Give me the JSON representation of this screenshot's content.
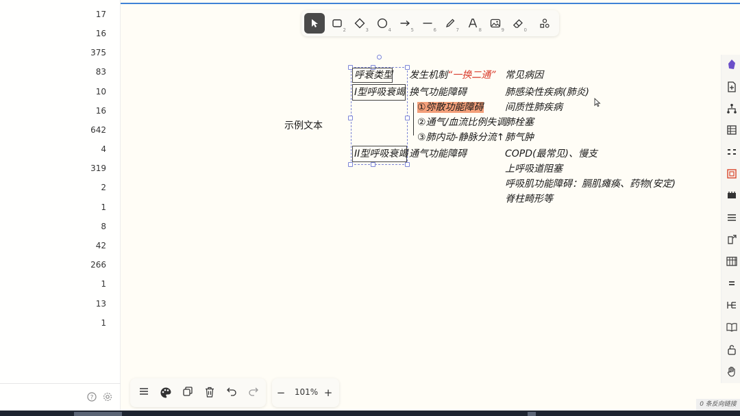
{
  "left_panel": {
    "counts": [
      "17",
      "16",
      "375",
      "83",
      "10",
      "16",
      "642",
      "4",
      "319",
      "2",
      "1",
      "8",
      "42",
      "266",
      "1",
      "13",
      "1"
    ],
    "footer_icons": [
      "help-icon",
      "settings-icon"
    ]
  },
  "toolbar": {
    "tools": [
      {
        "name": "select",
        "icon": "cursor-icon",
        "key": ""
      },
      {
        "name": "rectangle",
        "icon": "rectangle-icon",
        "key": "2"
      },
      {
        "name": "diamond",
        "icon": "diamond-icon",
        "key": "3"
      },
      {
        "name": "ellipse",
        "icon": "ellipse-icon",
        "key": "4"
      },
      {
        "name": "arrow",
        "icon": "arrow-icon",
        "key": "5"
      },
      {
        "name": "line",
        "icon": "line-icon",
        "key": "6"
      },
      {
        "name": "draw",
        "icon": "pencil-icon",
        "key": "7"
      },
      {
        "name": "text",
        "icon": "text-icon",
        "key": "8"
      },
      {
        "name": "image",
        "icon": "image-icon",
        "key": "9"
      },
      {
        "name": "eraser",
        "icon": "eraser-icon",
        "key": "0"
      },
      {
        "name": "library",
        "icon": "shapes-icon",
        "key": ""
      }
    ],
    "active_tool": "select"
  },
  "canvas": {
    "sample_text": "示例文本",
    "header": {
      "type": "呼衰类型",
      "mechanism_prefix": "发生机制",
      "mechanism_quote": "“一换二通”",
      "causes": "常见病因"
    },
    "type1": {
      "label": "I型呼吸衰竭",
      "mechanism": "换气功能障碍",
      "sub_items": [
        {
          "text": "①弥散功能障碍",
          "highlight": true
        },
        {
          "text": "②通气/血流比例失调",
          "highlight": false
        },
        {
          "text": "③肺内动-静脉分流↑",
          "highlight": false
        }
      ],
      "causes": [
        "肺感染性疾病(肺炎)",
        "间质性肺疾病",
        "肺栓塞",
        "肺气肿"
      ]
    },
    "type2": {
      "label": "II型呼吸衰竭",
      "mechanism": "通气功能障碍",
      "causes": [
        "COPD(最常见)、慢支",
        "上呼吸道阻塞",
        "呼吸肌功能障碍：膈肌瘫痪、药物(安定)",
        "脊柱畸形等"
      ]
    },
    "colors": {
      "accent_red": "#d93a2b",
      "highlight": "#f4a07a",
      "selection": "#7b84d6"
    }
  },
  "right_dock": {
    "icons": [
      "obsidian-icon",
      "new-file-icon",
      "graph-icon",
      "table-icon",
      "outline-icon",
      "focus-frame-icon",
      "calendar-icon",
      "list-icon",
      "open-external-icon",
      "kanban-icon",
      "heading-icon",
      "branch-icon",
      "book-icon",
      "unlock-icon",
      "hand-icon"
    ]
  },
  "bottom_tools": {
    "icons": [
      "menu-icon",
      "palette-icon",
      "duplicate-icon",
      "trash-icon",
      "undo-icon",
      "redo-icon"
    ]
  },
  "zoom": {
    "minus": "−",
    "value": "101%",
    "plus": "+"
  },
  "status": {
    "backlinks": "0 条反向链接"
  }
}
